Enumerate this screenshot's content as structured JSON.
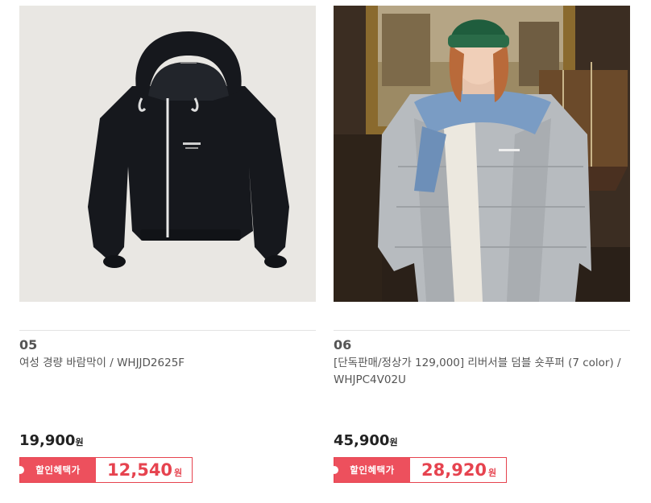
{
  "products": [
    {
      "rank": "05",
      "name": "여성 경량 바람막이 / WHJJD2625F",
      "price": "19,900",
      "currency": "원",
      "discount_label": "할인혜택가",
      "sale_price": "12,540",
      "image": "black-hooded-windbreaker-jacket"
    },
    {
      "rank": "06",
      "name": "[단독판매/정상가 129,000] 리버서블 덤블 숏푸퍼 (7 color) / WHJPC4V02U",
      "price": "45,900",
      "currency": "원",
      "discount_label": "할인혜택가",
      "sale_price": "28,920",
      "image": "model-in-grey-puffer-jacket"
    }
  ],
  "colors": {
    "accent": "#ed505d",
    "sale_text": "#e6434f"
  }
}
